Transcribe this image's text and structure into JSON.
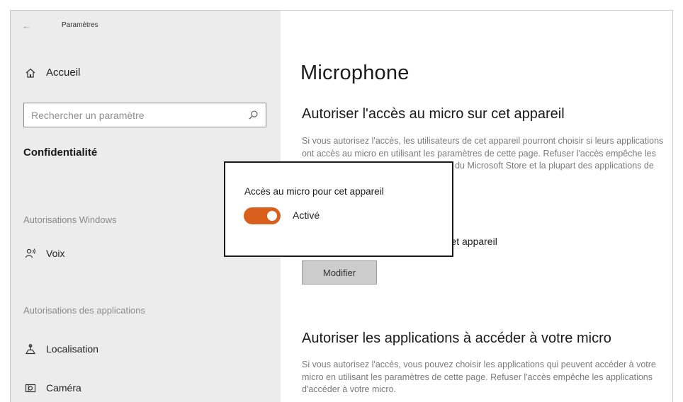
{
  "window": {
    "title": "Paramètres"
  },
  "sidebar": {
    "home_label": "Accueil",
    "search_placeholder": "Rechercher un paramètre",
    "section_heading": "Confidentialité",
    "group_windows": "Autorisations Windows",
    "voice_label": "Voix",
    "group_apps": "Autorisations des applications",
    "location_label": "Localisation",
    "camera_label": "Caméra"
  },
  "main": {
    "title": "Microphone",
    "section1_heading": "Autoriser l'accès au micro sur cet appareil",
    "section1_desc": "Si vous autorisez l'accès, les utilisateurs de cet appareil pourront choisir si leurs applications ont accès au micro en utilisant les paramètres de cette page. Refuser l'accès empêche les applications Windows, les applications du Microsoft Store et la plupart des applications de bureau d'accéder au micro.",
    "device_line": "L'accès au micro est activé pour cet appareil",
    "modify_button": "Modifier",
    "section2_heading": "Autoriser les applications à accéder à votre micro",
    "section2_desc": "Si vous autorisez l'accès, vous pouvez choisir les applications qui peuvent accéder à votre micro en utilisant les paramètres de cette page. Refuser l'accès empêche les applications d'accéder à votre micro."
  },
  "popup": {
    "title": "Accès au micro pour cet appareil",
    "toggle_state": "Activé",
    "toggle_on": true
  },
  "colors": {
    "accent": "#d9601c",
    "sidebar_bg": "#ececec"
  },
  "icons": {
    "back": "back-arrow-icon",
    "home": "home-icon",
    "search": "search-icon",
    "voice": "voice-icon",
    "location": "location-icon",
    "camera": "camera-icon"
  }
}
